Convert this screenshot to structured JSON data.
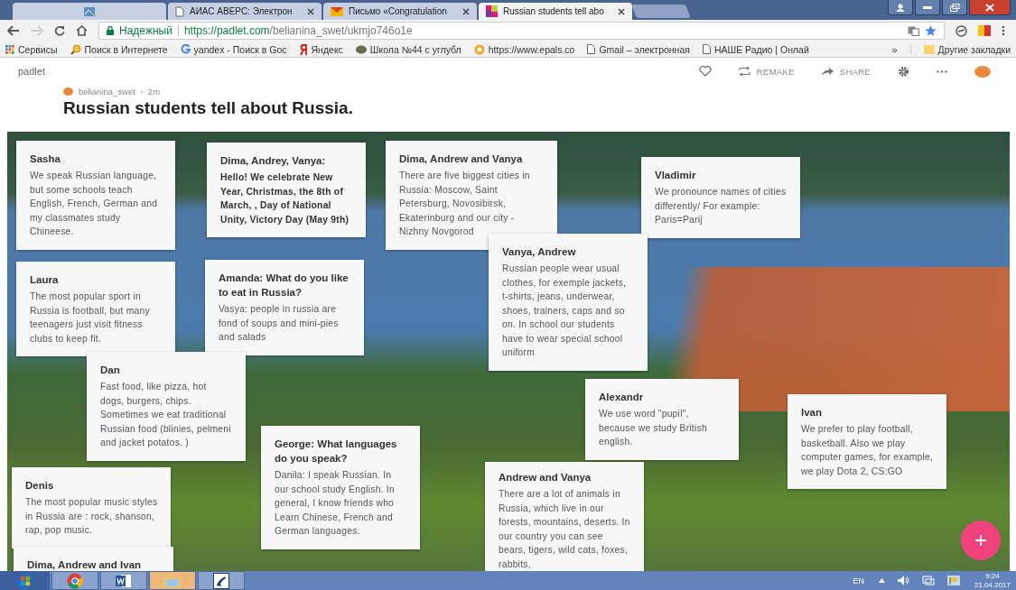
{
  "browser": {
    "tabs": [
      {
        "kind": "pinned",
        "selected": false
      },
      {
        "kind": "page",
        "title": "АИАС АВЕРС: Электрон",
        "selected": false
      },
      {
        "kind": "mail",
        "title": "Письмо «Congratulation",
        "selected": false
      },
      {
        "kind": "padlet",
        "title": "Russian students tell abo",
        "selected": true
      }
    ],
    "address": {
      "secure_label": "Надежный",
      "host": "https://padlet.com",
      "path": "/belianina_swet/ukmjo746o1e"
    },
    "bookmarks": [
      {
        "kind": "apps",
        "label": "Сервисы"
      },
      {
        "kind": "search",
        "label": "Поиск в Интернете"
      },
      {
        "kind": "google",
        "label": "yandex - Поиск в Goc"
      },
      {
        "kind": "yandex",
        "label": "Яндекс"
      },
      {
        "kind": "school",
        "label": "Школа №44 с углубл"
      },
      {
        "kind": "epals",
        "label": "https://www.epals.co"
      },
      {
        "kind": "page",
        "label": "Gmail – электронная"
      },
      {
        "kind": "page",
        "label": "НАШЕ Радио | Онлай"
      }
    ],
    "more_bookmarks": "»",
    "other_bookmarks": "Другие закладки"
  },
  "padlet": {
    "brand": "padlet",
    "actions": [
      {
        "kind": "like"
      },
      {
        "kind": "remake",
        "label": "REMAKE"
      },
      {
        "kind": "share",
        "label": "SHARE"
      },
      {
        "kind": "settings"
      },
      {
        "kind": "more"
      },
      {
        "kind": "avatar"
      }
    ],
    "author": "belianina_swet",
    "time": "2m",
    "title": "Russian students tell about Russia."
  },
  "posts": [
    {
      "author": "Sasha",
      "body": "We speak Russian language, but some schools teach English, French, German and my classmates study Chineese.",
      "bold": false
    },
    {
      "author": "Dima, Andrey, Vanya:",
      "body": "Hello! We celebrate  New Year, Christmas, the 8th of March, , Day of National Unity,  Victory Day (May 9th)",
      "bold": true
    },
    {
      "author": "Dima, Andrew and Vanya",
      "body": "There are five  biggest cities in Russia: Moscow, Saint Petersburg, Novosibirsk, Ekaterinburg and our city - Nizhny Novgorod",
      "bold": false
    },
    {
      "author": "Vladimir",
      "body": "We pronounce names of cities differently/ For example: Paris=Parij",
      "bold": false
    },
    {
      "author": "Vanya, Andrew",
      "body": "Russian people wear usual clothes, for exemple jackets, t-shirts, jeans, underwear, shoes, trainers,  caps and so on. In school our students have to wear special school uniform",
      "bold": false
    },
    {
      "author": "Laura",
      "body": "The most popular sport in Russia is football, but many teenagers just visit fitness clubs to keep fit.",
      "bold": false
    },
    {
      "author": "Amanda: What do you like to eat in Russia?",
      "body": "Vasya: people in russia are fond of soups and  mini-pies and salads",
      "bold": false
    },
    {
      "author": "Dan",
      "body": "Fast food, like pizza, hot dogs, burgers, chips. Sometimes we eat traditional Russian food (blinies, pelmeni and jacket potatos. )",
      "bold": false
    },
    {
      "author": "Alexandr",
      "body": "We use word \"pupil\", because we study British english.",
      "bold": false
    },
    {
      "author": "Ivan",
      "body": "We prefer to play football, basketball. Also we play computer games, for example, we play Dota 2, CS:GO",
      "bold": false
    },
    {
      "author": "Denis",
      "body": "The most popular music styles in Russia are : rock, shanson, rap, pop music.",
      "bold": false
    },
    {
      "author": "George: What languages do you speak?",
      "body": "Danila: I speak Russian. In our school study English. In general, I know friends who Learn Chinese, French and German languages.",
      "bold": false
    },
    {
      "author": "Dima, Andrew and Ivan"
    },
    {
      "author": "Andrew and Vanya",
      "body": "There are a lot of animals in Russia, which live in our forests, mountains, deserts. In our country you can see bears, tigers, wild cats, foxes, rabbits,",
      "bold": false
    }
  ],
  "taskbar": {
    "apps": [
      {
        "kind": "start"
      },
      {
        "kind": "chrome"
      },
      {
        "kind": "word"
      },
      {
        "kind": "folder"
      },
      {
        "kind": "phone"
      }
    ],
    "language": "EN",
    "time": "9:24",
    "date": "21.04.2017"
  }
}
